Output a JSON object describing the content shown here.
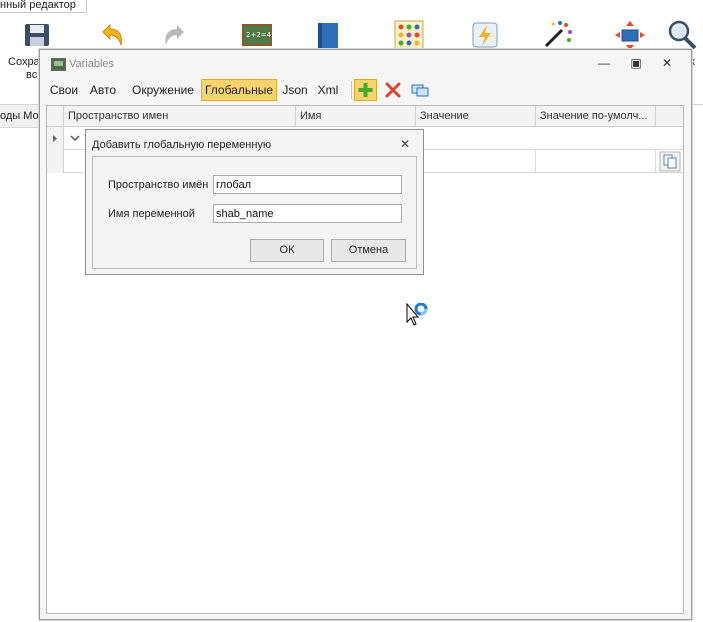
{
  "editor": {
    "tab_title": "нный редактор",
    "save_label_1": "Сохра",
    "save_label_2": "вс",
    "side_text": "оды Мо",
    "right_label": "к"
  },
  "variables_window": {
    "title": "Variables",
    "tabs": [
      {
        "label": "Свои"
      },
      {
        "label": "Авто"
      },
      {
        "label": "Окружение"
      },
      {
        "label": "Глобальные"
      },
      {
        "label": "Json"
      },
      {
        "label": "Xml"
      }
    ],
    "active_tab": "Глобальные",
    "columns": [
      "Пространство имен",
      "Имя",
      "Значение",
      "Значение по-умолч..."
    ]
  },
  "dialog": {
    "title": "Добавить глобальную переменную",
    "namespace_label": "Пространство имён",
    "namespace_value": "глобал",
    "varname_label": "Имя переменной",
    "varname_value": "shab_name",
    "ok_label": "ОК",
    "cancel_label": "Отмена"
  },
  "colors": {
    "active_tab_bg": "#fbd36c",
    "active_tab_border": "#e2aa2b",
    "add_icon": "#3fae2a",
    "delete_icon": "#e0412b"
  }
}
